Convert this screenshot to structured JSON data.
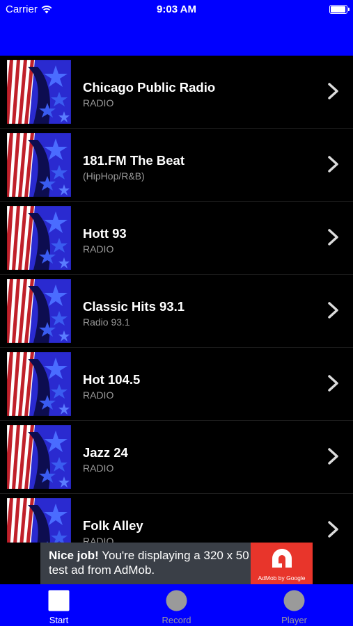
{
  "status_bar": {
    "carrier": "Carrier",
    "time": "9:03 AM",
    "battery_level": 1.0
  },
  "colors": {
    "header": "#0000ff",
    "background": "#000000",
    "subtitle": "#9a9a9a",
    "ad_background": "#3a3f47",
    "ad_brand": "#e8352b"
  },
  "stations": [
    {
      "title": "Chicago Public Radio",
      "subtitle": "RADIO"
    },
    {
      "title": "181.FM The Beat",
      "subtitle": "(HipHop/R&B)"
    },
    {
      "title": "Hott 93",
      "subtitle": "RADIO"
    },
    {
      "title": "Classic Hits 93.1",
      "subtitle": "Radio 93.1"
    },
    {
      "title": "Hot 104.5",
      "subtitle": "RADIO"
    },
    {
      "title": "Jazz 24",
      "subtitle": "RADIO"
    },
    {
      "title": "Folk Alley",
      "subtitle": "RADIO"
    }
  ],
  "ad": {
    "headline": "Nice job!",
    "body": " You're displaying a 320 x 50 test ad from AdMob.",
    "brand": "AdMob by Google"
  },
  "tabs": [
    {
      "label": "Start",
      "icon": "square-icon",
      "active": true
    },
    {
      "label": "Record",
      "icon": "circle-icon",
      "active": false
    },
    {
      "label": "Player",
      "icon": "circle-icon",
      "active": false
    }
  ]
}
